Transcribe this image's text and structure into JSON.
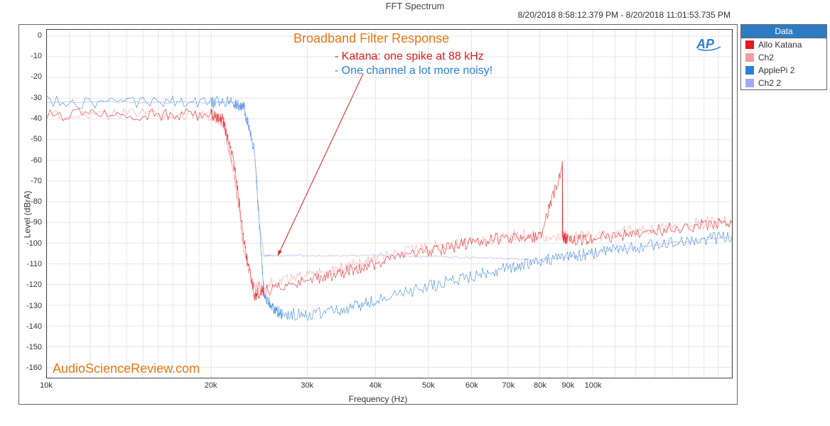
{
  "title": "FFT Spectrum",
  "timestamp": "8/20/2018 8:58:12.379 PM - 8/20/2018 11:01:53.735 PM",
  "xlabel": "Frequency (Hz)",
  "ylabel": "Level (dBrA)",
  "watermark": "AudioScienceReview.com",
  "badge": "AP",
  "legend": {
    "header": "Data",
    "items": [
      {
        "label": "Allo Katana",
        "color": "#e41a1c"
      },
      {
        "label": "Ch2",
        "color": "#f49ca0"
      },
      {
        "label": "ApplePi 2",
        "color": "#2a7fd8"
      },
      {
        "label": "Ch2 2",
        "color": "#a6a6ff"
      }
    ]
  },
  "annotations": {
    "title": "Broadband Filter Response",
    "line1": "- Katana: one spike at 88 kHz",
    "line2": "- One channel a lot more noisy!"
  },
  "axes": {
    "x_ticks": [
      10000,
      20000,
      30000,
      40000,
      50000,
      60000,
      70000,
      80000,
      90000,
      100000
    ],
    "x_tick_labels": [
      "10k",
      "20k",
      "30k",
      "40k",
      "50k",
      "60k",
      "70k",
      "80k",
      "90k",
      "100k"
    ],
    "x_range": [
      10000,
      180000
    ],
    "y_ticks": [
      0,
      -10,
      -20,
      -30,
      -40,
      -50,
      -60,
      -70,
      -80,
      -90,
      -100,
      -110,
      -120,
      -130,
      -140,
      -150,
      -160
    ],
    "y_range": [
      -165,
      3
    ]
  },
  "chart_data": {
    "type": "line",
    "xlabel": "Frequency (Hz)",
    "ylabel": "Level (dBrA)",
    "x_scale": "log",
    "xlim": [
      10000,
      180000
    ],
    "ylim": [
      -165,
      3
    ],
    "title": "FFT Spectrum",
    "annotations": [
      "Broadband Filter Response",
      "Katana: one spike at 88 kHz",
      "One channel a lot more noisy!"
    ],
    "series": [
      {
        "name": "Allo Katana",
        "color": "#e41a1c",
        "noise_amp_db": 3,
        "points": [
          [
            10000,
            -38
          ],
          [
            15000,
            -38
          ],
          [
            20000,
            -38
          ],
          [
            21000,
            -40
          ],
          [
            22000,
            -60
          ],
          [
            23000,
            -100
          ],
          [
            24000,
            -125
          ],
          [
            25000,
            -123
          ],
          [
            30000,
            -118
          ],
          [
            35000,
            -114
          ],
          [
            40000,
            -110
          ],
          [
            50000,
            -104
          ],
          [
            60000,
            -100
          ],
          [
            70000,
            -97
          ],
          [
            80000,
            -97
          ],
          [
            88000,
            -63
          ],
          [
            88200,
            -97
          ],
          [
            90000,
            -98
          ],
          [
            100000,
            -98
          ],
          [
            120000,
            -95
          ],
          [
            150000,
            -92
          ],
          [
            180000,
            -90
          ]
        ]
      },
      {
        "name": "Ch2",
        "color": "#f49ca0",
        "noise_amp_db": 3,
        "points": [
          [
            10000,
            -38
          ],
          [
            15000,
            -38
          ],
          [
            20000,
            -38
          ],
          [
            21000,
            -42
          ],
          [
            22000,
            -65
          ],
          [
            23000,
            -105
          ],
          [
            24000,
            -122
          ],
          [
            25000,
            -120
          ],
          [
            30000,
            -116
          ],
          [
            35000,
            -112
          ],
          [
            40000,
            -108
          ],
          [
            50000,
            -102
          ],
          [
            60000,
            -99
          ],
          [
            70000,
            -96
          ],
          [
            80000,
            -96
          ],
          [
            90000,
            -97
          ],
          [
            100000,
            -97
          ],
          [
            120000,
            -94
          ],
          [
            150000,
            -91
          ],
          [
            180000,
            -89
          ]
        ]
      },
      {
        "name": "ApplePi 2",
        "color": "#2a7fd8",
        "noise_amp_db": 3,
        "points": [
          [
            10000,
            -32
          ],
          [
            15000,
            -32
          ],
          [
            20000,
            -32
          ],
          [
            22000,
            -32
          ],
          [
            23000,
            -35
          ],
          [
            24000,
            -55
          ],
          [
            24500,
            -90
          ],
          [
            25000,
            -125
          ],
          [
            26000,
            -132
          ],
          [
            27000,
            -134
          ],
          [
            30000,
            -135
          ],
          [
            35000,
            -132
          ],
          [
            40000,
            -128
          ],
          [
            50000,
            -121
          ],
          [
            60000,
            -116
          ],
          [
            70000,
            -112
          ],
          [
            80000,
            -109
          ],
          [
            90000,
            -106
          ],
          [
            100000,
            -105
          ],
          [
            120000,
            -102
          ],
          [
            150000,
            -99
          ],
          [
            180000,
            -97
          ]
        ]
      },
      {
        "name": "Ch2 2",
        "color": "#a6a6ff",
        "noise_amp_db": 0.5,
        "points": [
          [
            10000,
            -32
          ],
          [
            15000,
            -32
          ],
          [
            20000,
            -32
          ],
          [
            22000,
            -32
          ],
          [
            23000,
            -35
          ],
          [
            24000,
            -55
          ],
          [
            24500,
            -90
          ],
          [
            25000,
            -106
          ],
          [
            26000,
            -106
          ],
          [
            30000,
            -106
          ],
          [
            40000,
            -106
          ],
          [
            50000,
            -106.5
          ],
          [
            60000,
            -107
          ],
          [
            70000,
            -107.5
          ],
          [
            80000,
            -108
          ],
          [
            90000,
            -107
          ],
          [
            100000,
            -105
          ],
          [
            120000,
            -102
          ],
          [
            150000,
            -99
          ],
          [
            180000,
            -97
          ]
        ]
      }
    ]
  }
}
